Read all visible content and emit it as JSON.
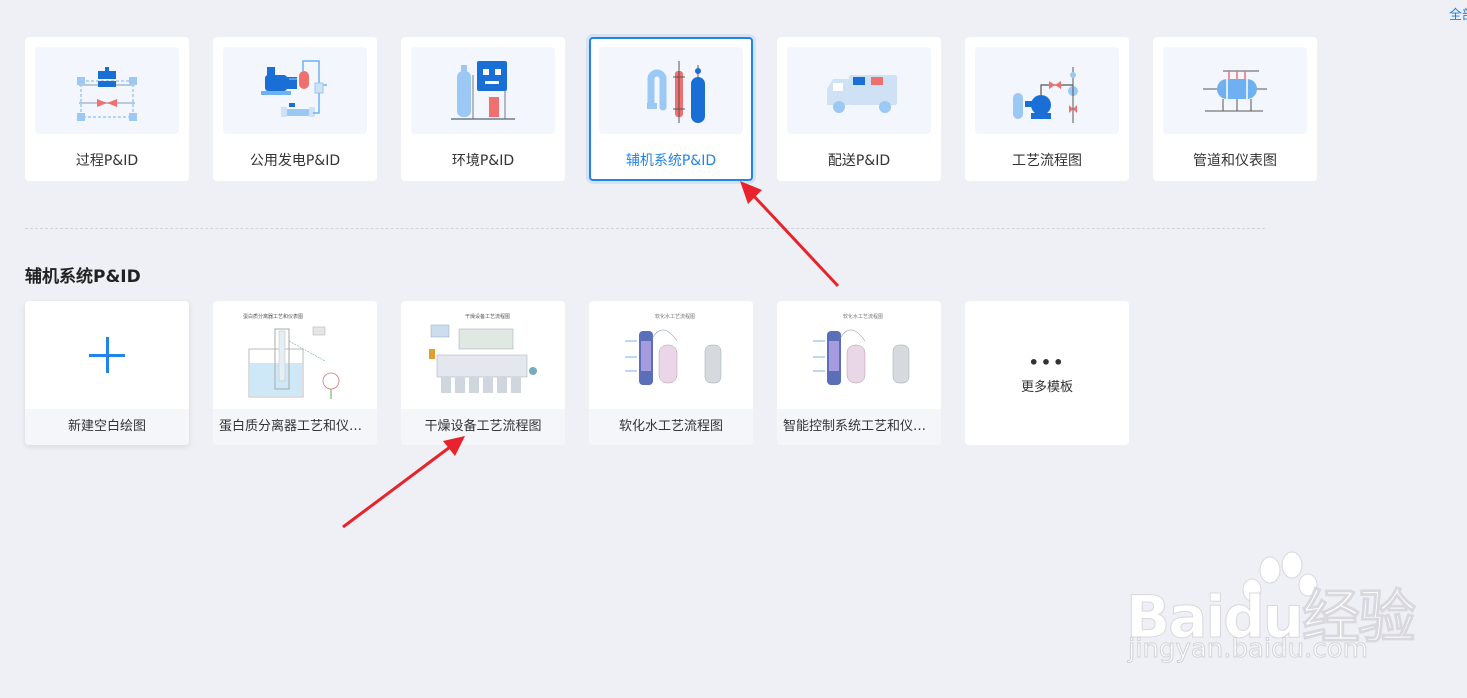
{
  "header": {
    "corner_link": "全部"
  },
  "categories": [
    {
      "label": "过程P&ID",
      "icon": "process-pid-icon"
    },
    {
      "label": "公用发电P&ID",
      "icon": "power-generation-pid-icon"
    },
    {
      "label": "环境P&ID",
      "icon": "environment-pid-icon"
    },
    {
      "label": "辅机系统P&ID",
      "icon": "auxiliary-system-pid-icon",
      "selected": true
    },
    {
      "label": "配送P&ID",
      "icon": "delivery-truck-icon"
    },
    {
      "label": "工艺流程图",
      "icon": "process-flow-icon"
    },
    {
      "label": "管道和仪表图",
      "icon": "piping-instrument-icon"
    }
  ],
  "section": {
    "title": "辅机系统P&ID"
  },
  "templates": {
    "new_blank": "新建空白绘图",
    "items": [
      {
        "caption": "蛋白质分离器工艺和仪表...",
        "preview_title": "蛋白质分离器工艺和仪表图"
      },
      {
        "caption": "干燥设备工艺流程图",
        "preview_title": "干燥设备工艺流程图"
      },
      {
        "caption": "软化水工艺流程图",
        "preview_title": "软化水工艺流程图"
      },
      {
        "caption": "智能控制系统工艺和仪表...",
        "preview_title": "软化水工艺流程图"
      }
    ],
    "more_dots": "•••",
    "more_label": "更多模板"
  },
  "watermark": {
    "brand": "Baidu经验",
    "url": "jingyan.baidu.com"
  },
  "colors": {
    "accent": "#1f85e6",
    "annotation_arrow": "#e8232b",
    "background": "#eff0f6"
  }
}
